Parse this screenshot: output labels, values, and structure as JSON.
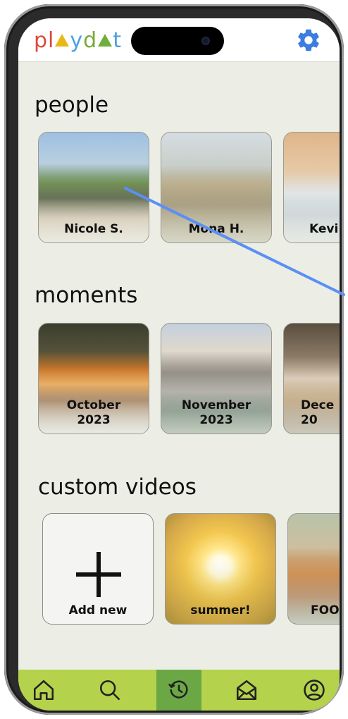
{
  "header": {
    "logo_text": "playdat",
    "logo_colors": [
      "#e0483a",
      "#d9463a",
      "#e8b818",
      "#4aa3df",
      "#7aa83a",
      "#6fae3c",
      "#4a9ee0"
    ]
  },
  "sections": {
    "people": {
      "title": "people",
      "cards": [
        {
          "label": "Nicole S."
        },
        {
          "label": "Mona H."
        },
        {
          "label": "Kevi"
        }
      ]
    },
    "moments": {
      "title": "moments",
      "cards": [
        {
          "label": "October\n2023"
        },
        {
          "label": "November\n2023"
        },
        {
          "label": "Dece\n20"
        }
      ]
    },
    "custom_videos": {
      "title": "custom videos",
      "cards": [
        {
          "label": "Add new"
        },
        {
          "label": "summer!"
        },
        {
          "label": "FOO"
        }
      ]
    }
  },
  "nav": {
    "items": [
      "home-icon",
      "search-icon",
      "history-icon",
      "inbox-icon",
      "profile-icon"
    ],
    "active": "history-icon",
    "color": "#b5d24c",
    "active_color": "#6ba845"
  },
  "colors": {
    "accent_gear": "#3b7de0",
    "annotation_line": "#5b8ff5",
    "background": "#eceee5"
  }
}
